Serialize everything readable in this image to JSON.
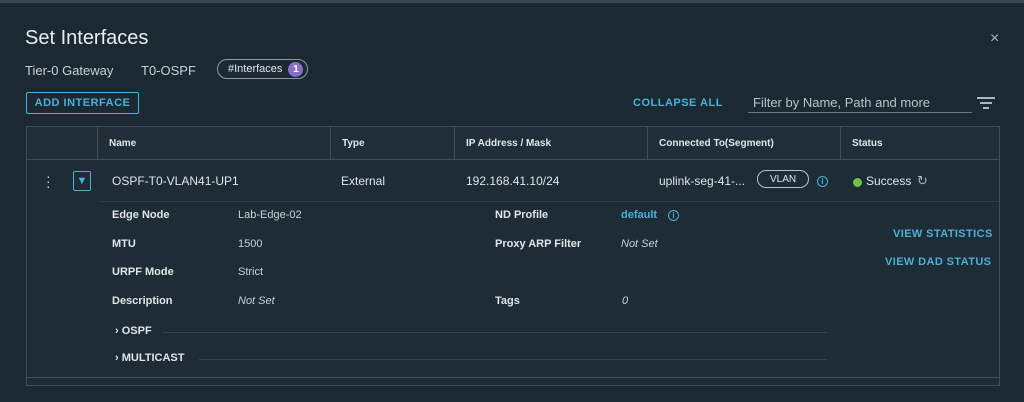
{
  "dialog": {
    "title": "Set Interfaces",
    "close": "×"
  },
  "context": {
    "gateway_type": "Tier-0 Gateway",
    "gateway_name": "T0-OSPF",
    "pill_label": "#Interfaces",
    "pill_count": "1"
  },
  "toolbar": {
    "add_label": "ADD INTERFACE",
    "collapse_label": "COLLAPSE ALL",
    "filter_placeholder": "Filter by Name, Path and more"
  },
  "columns": [
    "Name",
    "Type",
    "IP Address / Mask",
    "Connected To(Segment)",
    "Status"
  ],
  "row": {
    "name": "OSPF-T0-VLAN41-UP1",
    "type": "External",
    "ip": "192.168.41.10/24",
    "segment": "uplink-seg-41-...",
    "segment_badge": "VLAN",
    "status": "Success"
  },
  "details": {
    "edge_node_label": "Edge Node",
    "edge_node": "Lab-Edge-02",
    "mtu_label": "MTU",
    "mtu": "1500",
    "urpf_label": "URPF Mode",
    "urpf": "Strict",
    "desc_label": "Description",
    "desc": "Not Set",
    "nd_label": "ND Profile",
    "nd": "default",
    "proxy_label": "Proxy ARP Filter",
    "proxy": "Not Set",
    "tags_label": "Tags",
    "tags": "0"
  },
  "actions": {
    "view_stats": "VIEW STATISTICS",
    "view_dad": "VIEW DAD STATUS"
  },
  "sections": {
    "ospf": "OSPF",
    "multicast": "MULTICAST"
  },
  "colors": {
    "accent": "#49afd9",
    "success": "#6cc14a",
    "badge": "#8a6fc7"
  }
}
